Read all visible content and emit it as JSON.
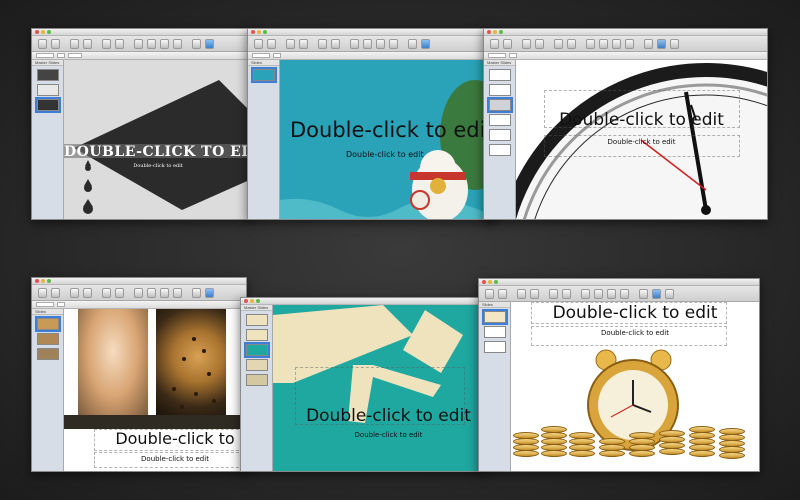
{
  "windows": [
    {
      "id": "w1",
      "title": "",
      "navigator_label": "Master Slides",
      "title_text": "DOUBLE-CLICK TO EDIT",
      "subtitle_text": "Double-click to edit"
    },
    {
      "id": "w2",
      "title": "",
      "navigator_label": "Slides",
      "title_text": "Double-click to edit",
      "subtitle_text": "Double-click to edit"
    },
    {
      "id": "w3",
      "title": "",
      "navigator_label": "Master Slides",
      "title_text": "Double-click to edit",
      "subtitle_text": "Double-click to edit"
    },
    {
      "id": "w4",
      "title": "",
      "navigator_label": "Slides",
      "title_text": "Double-click to",
      "subtitle_text": "Double-click to edit"
    },
    {
      "id": "w5",
      "title": "",
      "navigator_label": "Master Slides",
      "title_text": "Double-click to edit",
      "subtitle_text": "Double-click to edit"
    },
    {
      "id": "w6",
      "title": "",
      "navigator_label": "Slides",
      "title_text": "Double-click to edit",
      "subtitle_text": "Double-click to edit"
    }
  ],
  "colors": {
    "teal": "#2aa3b8",
    "teal_green": "#1ea8a0",
    "cream": "#efe3bd",
    "dark_slide": "#2b2b2b",
    "gold": "#d9a53a",
    "selection_blue": "#3d7fd6"
  }
}
